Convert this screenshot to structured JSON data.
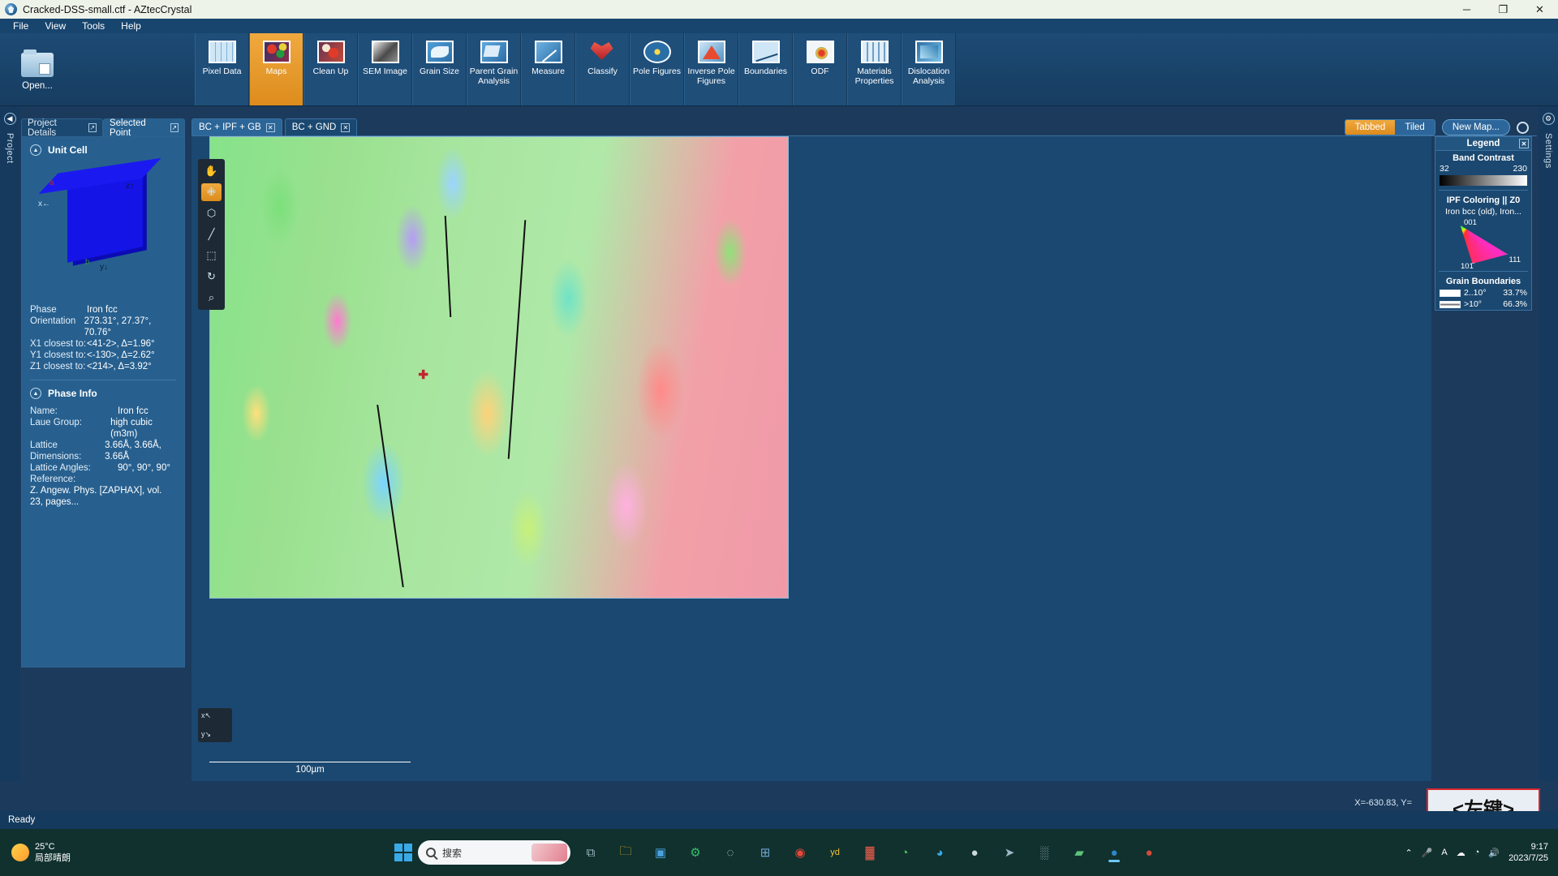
{
  "window": {
    "title": "Cracked-DSS-small.ctf - AZtecCrystal",
    "minimize": "─",
    "maximize": "❐",
    "close": "✕"
  },
  "menu": {
    "items": [
      "File",
      "View",
      "Tools",
      "Help"
    ]
  },
  "ribbon": {
    "open_label": "Open...",
    "buttons": [
      {
        "label": "Pixel Data",
        "icon": "table-grid-icon",
        "active": false
      },
      {
        "label": "Maps",
        "icon": "maps-icon",
        "active": true
      },
      {
        "label": "Clean Up",
        "icon": "clean-up-wand-icon",
        "active": false
      },
      {
        "label": "SEM Image",
        "icon": "sem-image-icon",
        "active": false
      },
      {
        "label": "Grain Size",
        "icon": "grain-size-icon",
        "active": false
      },
      {
        "label": "Parent Grain Analysis",
        "icon": "parent-grain-icon",
        "active": false
      },
      {
        "label": "Measure",
        "icon": "measure-ruler-icon",
        "active": false
      },
      {
        "label": "Classify",
        "icon": "classify-shield-icon",
        "active": false
      },
      {
        "label": "Pole Figures",
        "icon": "pole-figures-icon",
        "active": false
      },
      {
        "label": "Inverse Pole Figures",
        "icon": "inverse-pole-figures-icon",
        "active": false
      },
      {
        "label": "Boundaries",
        "icon": "boundaries-icon",
        "active": false
      },
      {
        "label": "ODF",
        "icon": "odf-icon",
        "active": false
      },
      {
        "label": "Materials Properties",
        "icon": "materials-properties-icon",
        "active": false
      },
      {
        "label": "Dislocation Analysis",
        "icon": "dislocation-analysis-icon",
        "active": false
      }
    ]
  },
  "left_rail": {
    "label": "Project",
    "icon": "circle-arrow-left-icon"
  },
  "right_rail": {
    "label": "Settings",
    "icon": "gear-icon"
  },
  "panel": {
    "tabs": [
      {
        "label": "Project Details",
        "selected": false
      },
      {
        "label": "Selected Point",
        "selected": true
      }
    ],
    "unit_cell": {
      "title": "Unit Cell",
      "axes": {
        "a": "a",
        "b": "b",
        "c": "c",
        "x": "x←",
        "y": "y↓",
        "z": "z↑"
      }
    },
    "selected_point": [
      {
        "key": "Phase",
        "value": "Iron fcc"
      },
      {
        "key": "Orientation",
        "value": "273.31°, 27.37°, 70.76°"
      },
      {
        "key": "X1 closest to:",
        "value": "<41-2>, Δ=1.96°"
      },
      {
        "key": "Y1 closest to:",
        "value": "<-130>, Δ=2.62°"
      },
      {
        "key": "Z1 closest to:",
        "value": "<214>, Δ=3.92°"
      }
    ],
    "phase_info": {
      "title": "Phase Info",
      "rows": [
        {
          "key": "Name:",
          "value": "Iron fcc"
        },
        {
          "key": "Laue Group:",
          "value": "high cubic (m3m)"
        },
        {
          "key": "Lattice Dimensions:",
          "value": "3.66Å, 3.66Å, 3.66Å"
        },
        {
          "key": "Lattice Angles:",
          "value": "90°, 90°, 90°"
        },
        {
          "key": "Reference:",
          "value": ""
        }
      ],
      "reference": "Z. Angew. Phys. [ZAPHAX], vol. 23, pages..."
    }
  },
  "map_tabs": [
    {
      "label": "BC + IPF + GB",
      "selected": true,
      "close": "✕"
    },
    {
      "label": "BC + GND",
      "selected": false,
      "close": "✕"
    }
  ],
  "view_controls": {
    "tabbed": "Tabbed",
    "tiled": "Tiled",
    "new_map": "New Map...",
    "gear": "gear-icon"
  },
  "map_tools": [
    {
      "name": "pan-hand-tool",
      "glyph": "✋",
      "active": false
    },
    {
      "name": "point-select-tool",
      "glyph": "✙",
      "active": true
    },
    {
      "name": "polygon-select-tool",
      "glyph": "⬡",
      "active": false
    },
    {
      "name": "line-measure-tool",
      "glyph": "╱",
      "active": false
    },
    {
      "name": "rectangle-crop-tool",
      "glyph": "⬚",
      "active": false
    },
    {
      "name": "rotate-tool",
      "glyph": "↻",
      "active": false
    },
    {
      "name": "zoom-region-tool",
      "glyph": "⌕",
      "active": false
    }
  ],
  "map": {
    "scale_bar_label": "100µm",
    "axis_widget": {
      "x": "x↖",
      "y": "y↘"
    }
  },
  "legend": {
    "title": "Legend",
    "close": "✕",
    "band_contrast": {
      "title": "Band Contrast",
      "min": "32",
      "max": "230"
    },
    "ipf": {
      "title": "IPF Coloring || Z0",
      "phases": "Iron bcc (old), Iron...",
      "corner_top": "001",
      "corner_left": "101",
      "corner_right": "111"
    },
    "grain_boundaries": {
      "title": "Grain Boundaries",
      "rows": [
        {
          "label": "2..10°",
          "percent": "33.7%"
        },
        {
          "label": ">10°",
          "percent": "66.3%"
        }
      ]
    }
  },
  "status": {
    "ready": "Ready",
    "coords": "X=-630.83, Y=",
    "overlay_text": "<左键>"
  },
  "taskbar": {
    "weather_temp": "25°C",
    "weather_desc": "局部晴朗",
    "search_placeholder": "搜索",
    "clock_time": "9:17",
    "clock_date": "2023/7/25",
    "apps": [
      {
        "name": "task-view-icon",
        "glyph": "⧉",
        "color": "#9fb6c4"
      },
      {
        "name": "file-explorer-icon",
        "glyph": "🗀",
        "color": "#f0b429"
      },
      {
        "name": "photos-icon",
        "glyph": "▣",
        "color": "#4aa3df"
      },
      {
        "name": "settings-green-icon",
        "glyph": "⚙",
        "color": "#36c06a"
      },
      {
        "name": "browser-icon",
        "glyph": "◌",
        "color": "#cfd8de"
      },
      {
        "name": "calculator-icon",
        "glyph": "⊞",
        "color": "#6fa8d6"
      },
      {
        "name": "record-red-icon",
        "glyph": "◉",
        "color": "#e4483a"
      },
      {
        "name": "media-yellow-icon",
        "glyph": "yd",
        "color": "#f2c23a"
      },
      {
        "name": "music-bars-icon",
        "glyph": "▓",
        "color": "#e05a4a"
      },
      {
        "name": "wechat-icon",
        "glyph": "◔",
        "color": "#4bc55a"
      },
      {
        "name": "edge-icon",
        "glyph": "◕",
        "color": "#3aa9e8"
      },
      {
        "name": "steam-icon",
        "glyph": "●",
        "color": "#cfd8de"
      },
      {
        "name": "rocket-icon",
        "glyph": "➤",
        "color": "#9fb6c4"
      },
      {
        "name": "stats-icon",
        "glyph": "░",
        "color": "#b6c4cf"
      },
      {
        "name": "app-green-icon",
        "glyph": "▰",
        "color": "#5ec27a"
      },
      {
        "name": "aztec-crystal-icon",
        "glyph": "●",
        "color": "#2e86c8",
        "active": true
      },
      {
        "name": "red-app-icon",
        "glyph": "●",
        "color": "#d64a3a"
      }
    ],
    "tray": [
      {
        "name": "chevron-up-icon",
        "glyph": "⌃"
      },
      {
        "name": "microphone-icon",
        "glyph": "🎤"
      },
      {
        "name": "ime-icon",
        "glyph": "A"
      },
      {
        "name": "cloud-sync-icon",
        "glyph": "☁"
      },
      {
        "name": "wifi-icon",
        "glyph": "◔"
      },
      {
        "name": "volume-icon",
        "glyph": "🔊"
      }
    ]
  }
}
